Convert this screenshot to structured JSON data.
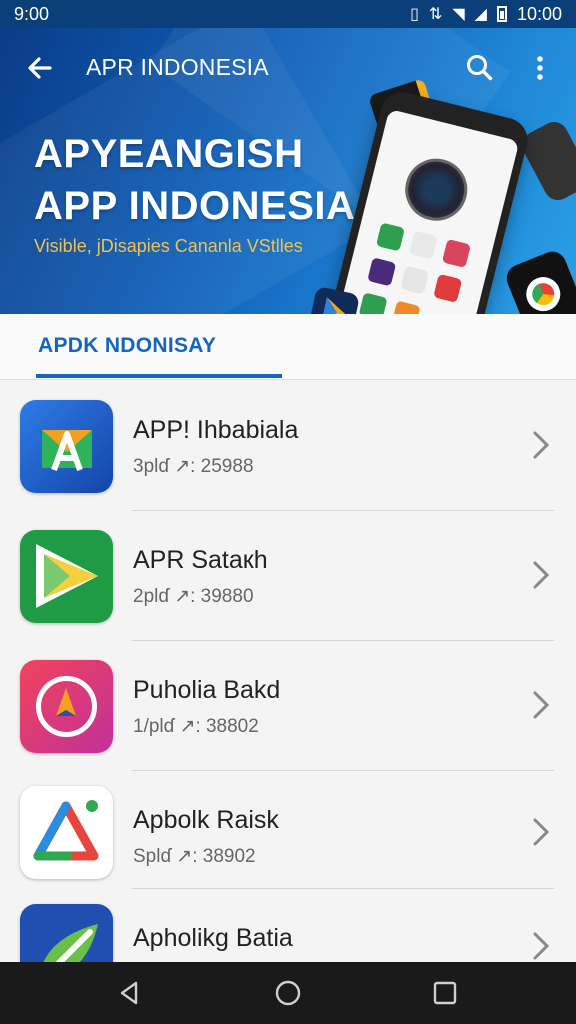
{
  "status_bar": {
    "time_left": "9:00",
    "time_right": "10:00"
  },
  "toolbar": {
    "title": "APR INDONESIA",
    "back_icon": "arrow-left-icon",
    "search_icon": "search-icon",
    "menu_icon": "more-vert-icon"
  },
  "hero": {
    "title_line1": "APYEANGISH",
    "title_line2": "APP INDONESIA",
    "subtitle": "Visible, jDisapies Cananla VStlles"
  },
  "tabs": [
    {
      "label": "APDK NDONISAY",
      "selected": true
    }
  ],
  "apps": [
    {
      "name": "APP! Ihbabiala",
      "meta": "3plɗ ↗: 25988"
    },
    {
      "name": "APR Sataкh",
      "meta": "2plɗ ↗: 39880"
    },
    {
      "name": "Puholia Bakd",
      "meta": "1/plɗ ↗: 38802"
    },
    {
      "name": "Apbolk Raisk",
      "meta": "Splɗ ↗: 38902"
    },
    {
      "name": "Apholikg Batia",
      "meta": ""
    }
  ],
  "nav_bar": {
    "back_icon": "nav-back-icon",
    "home_icon": "nav-home-icon",
    "recents_icon": "nav-recents-icon"
  },
  "colors": {
    "accent": "#1565c0",
    "hero_dark": "#0a3c86",
    "hero_light": "#2aa1e6",
    "subtitle": "#f3c04a"
  }
}
